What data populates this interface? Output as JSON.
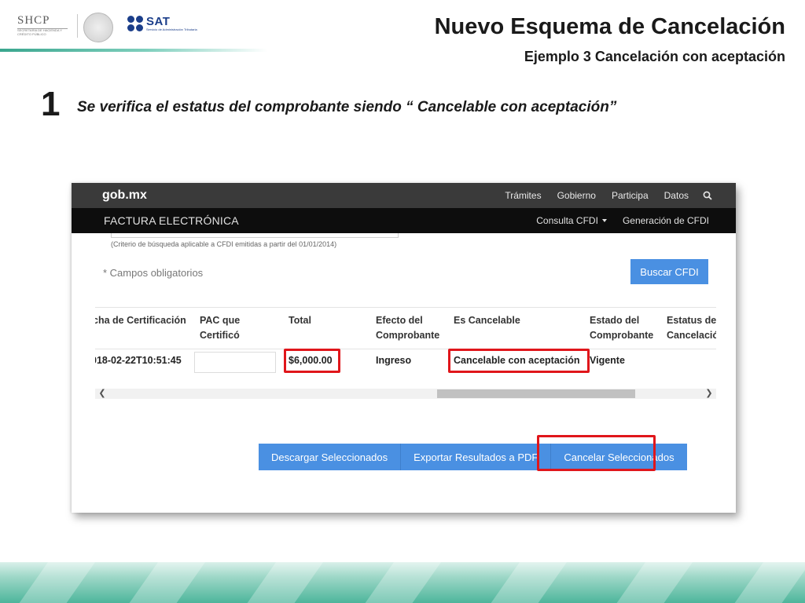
{
  "header": {
    "shcp_logo": {
      "word": "SHCP",
      "subtitle": "SECRETARÍA DE HACIENDA Y CRÉDITO PÚBLICO"
    },
    "sat_logo": {
      "word": "SAT",
      "subtitle": "Servicio de Administración Tributaria"
    },
    "title": "Nuevo Esquema de Cancelación",
    "subtitle": "Ejemplo 3 Cancelación con aceptación"
  },
  "step": {
    "number": "1",
    "text": "Se verifica el estatus del comprobante siendo “ Cancelable con aceptación”"
  },
  "portal": {
    "gob_logo": "gob.mx",
    "top_nav": [
      "Trámites",
      "Gobierno",
      "Participa",
      "Datos"
    ],
    "section_title": "FACTURA ELECTRÓNICA",
    "section_nav": {
      "consulta": "Consulta CFDI",
      "generacion": "Generación de CFDI"
    },
    "criteria_note": "(Criterio de búsqueda aplicable a CFDI emitidas a partir del 01/01/2014)",
    "required_note": "* Campos obligatorios",
    "search_button": "Buscar CFDI",
    "table": {
      "headers": {
        "fecha": "cha de Certificación",
        "pac_1": "PAC que",
        "pac_2": "Certificó",
        "total": "Total",
        "efecto_1": "Efecto del",
        "efecto_2": "Comprobante",
        "cancelable": "Es Cancelable",
        "estado_1": "Estado del",
        "estado_2": "Comprobante",
        "estatus_1": "Estatus de",
        "estatus_2": "Cancelació"
      },
      "row": {
        "fecha": "018-02-22T10:51:45",
        "pac": "",
        "total": "$6,000.00",
        "efecto": "Ingreso",
        "cancelable": "Cancelable con aceptación",
        "estado": "Vigente",
        "estatus": ""
      }
    },
    "actions": {
      "download": "Descargar Seleccionados",
      "export": "Exportar Resultados a PDF",
      "cancel": "Cancelar Seleccionados"
    }
  },
  "colors": {
    "highlight": "#e0161b",
    "primary_button": "#4a90e2",
    "gob_bar": "#3a3a3a",
    "section_bar": "#0d0d0d",
    "accent_green": "#4db59b",
    "sat_blue": "#1b3e8a"
  },
  "icons": {
    "search": "search-icon",
    "dropdown": "caret-icon",
    "scroll_left": "chevron-left-icon",
    "scroll_right": "chevron-right-icon"
  }
}
